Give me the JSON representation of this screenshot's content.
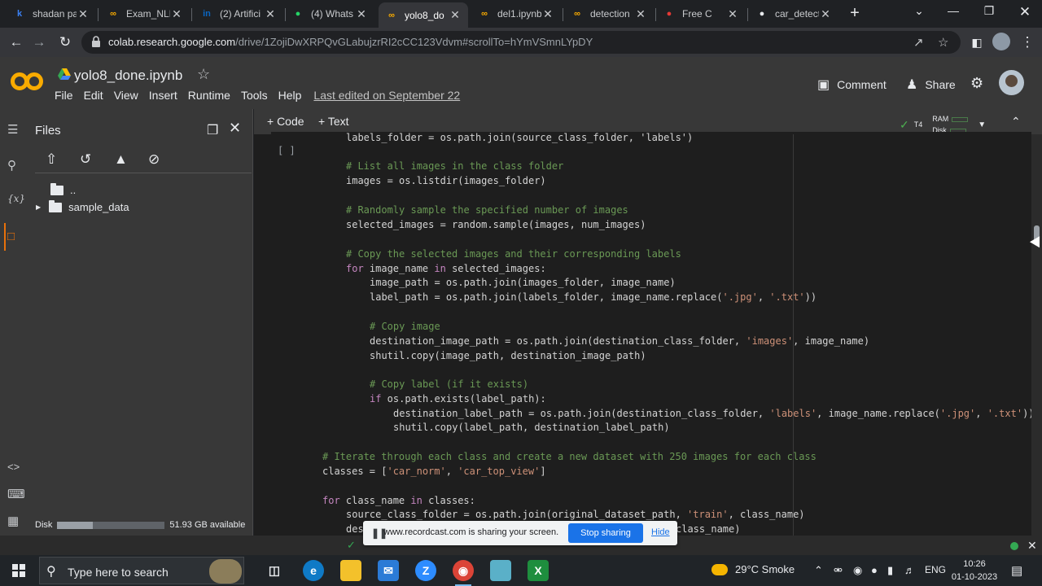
{
  "browser": {
    "tabs": [
      {
        "title": "shadan pa",
        "icon": "k-icon",
        "color": "#3b82f6"
      },
      {
        "title": "Exam_NLP",
        "icon": "colab-icon",
        "color": "#f9ab00"
      },
      {
        "title": "(2) Artifici",
        "icon": "linkedin-icon",
        "color": "#0a66c2"
      },
      {
        "title": "(4) Whats",
        "icon": "whatsapp-icon",
        "color": "#25d366"
      },
      {
        "title": "yolo8_do",
        "icon": "colab-icon",
        "color": "#f9ab00",
        "active": true
      },
      {
        "title": "del1.ipynb",
        "icon": "colab-icon",
        "color": "#f9ab00"
      },
      {
        "title": "detection",
        "icon": "colab-icon",
        "color": "#f9ab00"
      },
      {
        "title": "Free C",
        "icon": "recordcast-icon",
        "color": "#e53935"
      },
      {
        "title": "car_detect",
        "icon": "github-icon",
        "color": "#e8eaed"
      }
    ],
    "url_host": "colab.research.google.com",
    "url_path": "/drive/1ZojiDwXRPQvGLabujzrRI2cCC123Vdvm#scrollTo=hYmVSmnLYpDY"
  },
  "colab": {
    "notebook_name": "yolo8_done.ipynb",
    "menu": [
      "File",
      "Edit",
      "View",
      "Insert",
      "Runtime",
      "Tools",
      "Help"
    ],
    "last_edited": "Last edited on September 22",
    "comment_label": "Comment",
    "share_label": "Share",
    "add_code_label": "+ Code",
    "add_text_label": "+ Text",
    "runtime_label": "T4",
    "ram_label": "RAM",
    "disk_label": "Disk"
  },
  "files_panel": {
    "title": "Files",
    "tree": [
      {
        "name": "..",
        "type": "parent"
      },
      {
        "name": "sample_data",
        "type": "folder"
      }
    ],
    "disk_label": "Disk",
    "disk_available": "51.93 GB available",
    "disk_used_fraction": 0.33
  },
  "cell": {
    "run_indicator": "[ ]",
    "lines": [
      {
        "indent": 2,
        "spans": [
          [
            "",
            "labels_folder = os.path.join(source_class_folder, 'labels')"
          ]
        ]
      },
      {
        "indent": 2,
        "spans": [
          [
            "c",
            "# List all images in the class folder"
          ]
        ]
      },
      {
        "indent": 2,
        "spans": [
          [
            "",
            "images = os.listdir(images_folder)"
          ]
        ]
      },
      {
        "indent": 0,
        "spans": []
      },
      {
        "indent": 2,
        "spans": [
          [
            "c",
            "# Randomly sample the specified number of images"
          ]
        ]
      },
      {
        "indent": 2,
        "spans": [
          [
            "",
            "selected_images = random.sample(images, num_images)"
          ]
        ]
      },
      {
        "indent": 0,
        "spans": []
      },
      {
        "indent": 2,
        "spans": [
          [
            "c",
            "# Copy the selected images and their corresponding labels"
          ]
        ]
      },
      {
        "indent": 2,
        "spans": [
          [
            "k",
            "for"
          ],
          [
            "",
            " image_name "
          ],
          [
            "k",
            "in"
          ],
          [
            "",
            " selected_images:"
          ]
        ]
      },
      {
        "indent": 3,
        "spans": [
          [
            "",
            "image_path = os.path.join(images_folder, image_name)"
          ]
        ]
      },
      {
        "indent": 3,
        "spans": [
          [
            "",
            "label_path = os.path.join(labels_folder, image_name.replace("
          ],
          [
            "s",
            "'.jpg'"
          ],
          [
            "",
            ", "
          ],
          [
            "s",
            "'.txt'"
          ],
          [
            "",
            "))"
          ]
        ]
      },
      {
        "indent": 0,
        "spans": []
      },
      {
        "indent": 3,
        "spans": [
          [
            "c",
            "# Copy image"
          ]
        ]
      },
      {
        "indent": 3,
        "spans": [
          [
            "",
            "destination_image_path = os.path.join(destination_class_folder, "
          ],
          [
            "s",
            "'images'"
          ],
          [
            "",
            ", image_name)"
          ]
        ]
      },
      {
        "indent": 3,
        "spans": [
          [
            "",
            "shutil.copy(image_path, destination_image_path)"
          ]
        ]
      },
      {
        "indent": 0,
        "spans": []
      },
      {
        "indent": 3,
        "spans": [
          [
            "c",
            "# Copy label (if it exists)"
          ]
        ]
      },
      {
        "indent": 3,
        "spans": [
          [
            "k",
            "if"
          ],
          [
            "",
            " os.path.exists(label_path):"
          ]
        ]
      },
      {
        "indent": 4,
        "spans": [
          [
            "",
            "destination_label_path = os.path.join(destination_class_folder, "
          ],
          [
            "s",
            "'labels'"
          ],
          [
            "",
            ", image_name.replace("
          ],
          [
            "s",
            "'.jpg'"
          ],
          [
            "",
            ", "
          ],
          [
            "s",
            "'.txt'"
          ],
          [
            "",
            "))"
          ]
        ]
      },
      {
        "indent": 4,
        "spans": [
          [
            "",
            "shutil.copy(label_path, destination_label_path)"
          ]
        ]
      },
      {
        "indent": 0,
        "spans": []
      },
      {
        "indent": 1,
        "spans": [
          [
            "c",
            "# Iterate through each class and create a new dataset with 250 images for each class"
          ]
        ]
      },
      {
        "indent": 1,
        "spans": [
          [
            "",
            "classes = ["
          ],
          [
            "s",
            "'car_norm'"
          ],
          [
            "",
            ", "
          ],
          [
            "s",
            "'car_top_view'"
          ],
          [
            "",
            "]"
          ]
        ]
      },
      {
        "indent": 0,
        "spans": []
      },
      {
        "indent": 1,
        "spans": [
          [
            "k",
            "for"
          ],
          [
            "",
            " class_name "
          ],
          [
            "k",
            "in"
          ],
          [
            "",
            " classes:"
          ]
        ]
      },
      {
        "indent": 2,
        "spans": [
          [
            "",
            "source_class_folder = os.path.join(original_dataset_path, "
          ],
          [
            "s",
            "'train'"
          ],
          [
            "",
            ", class_name)"
          ]
        ]
      },
      {
        "indent": 2,
        "spans": [
          [
            "",
            "destin"
          ]
        ]
      }
    ],
    "last_line_tail": "class_name)"
  },
  "share_bar": {
    "message": "www.recordcast.com is sharing your screen.",
    "stop_label": "Stop sharing",
    "hide_label": "Hide"
  },
  "taskbar": {
    "search_placeholder": "Type here to search",
    "weather": "29°C  Smoke",
    "language": "ENG",
    "time": "10:26",
    "date": "01-10-2023"
  }
}
